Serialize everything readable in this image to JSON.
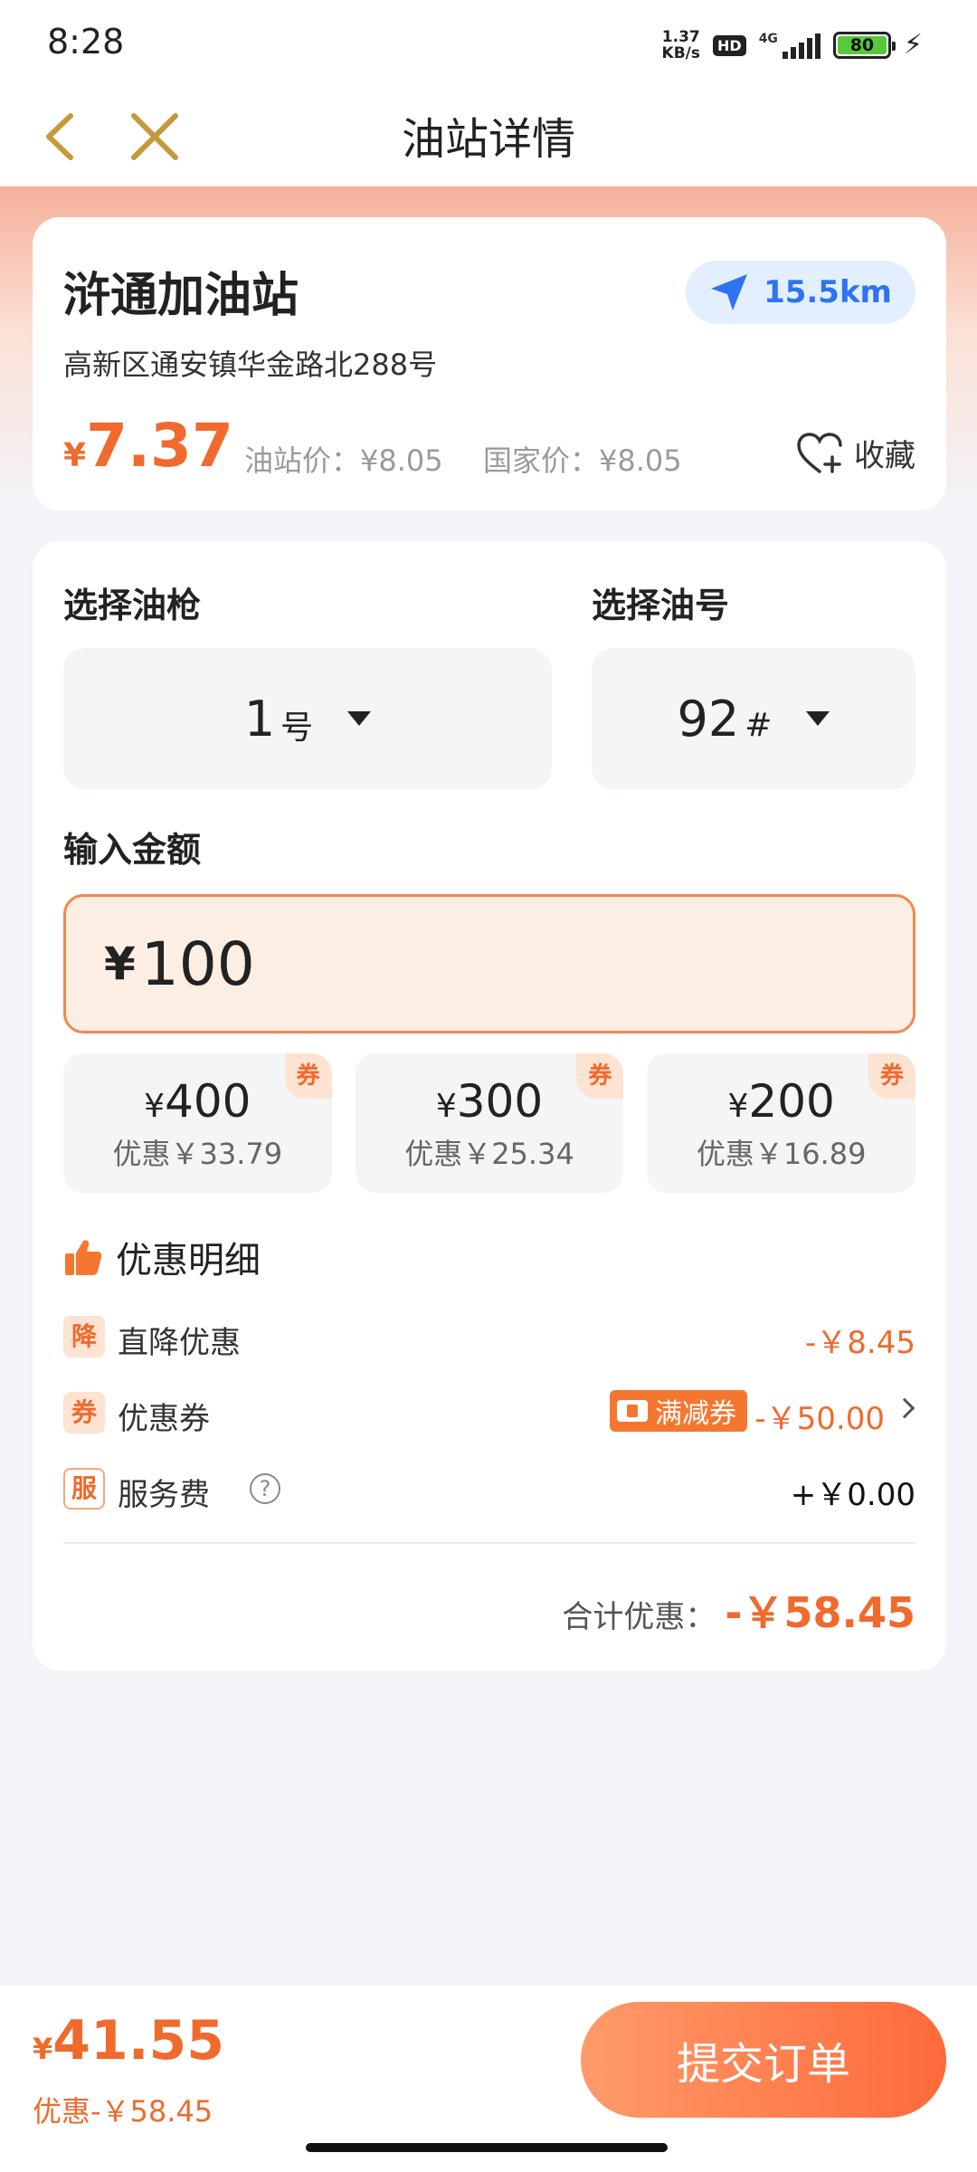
{
  "status_bar": {
    "time": "8:28",
    "net_speed_value": "1.37",
    "net_speed_unit": "KB/s",
    "hd": "HD",
    "network": "4G",
    "battery": "80"
  },
  "nav": {
    "title": "油站详情"
  },
  "station": {
    "name": "浒通加油站",
    "distance": "15.5km",
    "address": "高新区通安镇华金路北288号",
    "member_price_currency": "¥",
    "member_price": "7.37",
    "station_price": "油站价：¥8.05",
    "national_price": "国家价：¥8.05",
    "favorite_label": "收藏"
  },
  "form": {
    "nozzle_label": "选择油枪",
    "nozzle_value": "1",
    "nozzle_unit": "号",
    "fuel_label": "选择油号",
    "fuel_value": "92",
    "fuel_unit": "#",
    "amount_label": "输入金额",
    "amount_currency": "¥",
    "amount_value": "100",
    "presets": [
      {
        "currency": "¥",
        "amount": "400",
        "discount": "优惠￥33.79",
        "tag": "券"
      },
      {
        "currency": "¥",
        "amount": "300",
        "discount": "优惠￥25.34",
        "tag": "券"
      },
      {
        "currency": "¥",
        "amount": "200",
        "discount": "优惠￥16.89",
        "tag": "券"
      }
    ]
  },
  "discount_detail": {
    "title": "优惠明细",
    "rows": [
      {
        "tag": "降",
        "label": "直降优惠",
        "value": "-￥8.45"
      },
      {
        "tag": "券",
        "label": "优惠券",
        "chip": "满减券",
        "value": "-￥50.00"
      },
      {
        "tag": "服",
        "label": "服务费",
        "help": "?",
        "value": "+￥0.00"
      }
    ],
    "total_label": "合计优惠：",
    "total_value": "-￥58.45"
  },
  "bottom": {
    "pay_currency": "¥",
    "pay_amount": "41.55",
    "pay_discount": "优惠-￥58.45",
    "submit_label": "提交订单"
  },
  "colors": {
    "accent": "#f06a2d",
    "distance_blue": "#2f73f0",
    "nav_icon_gold": "#c49a3a"
  }
}
